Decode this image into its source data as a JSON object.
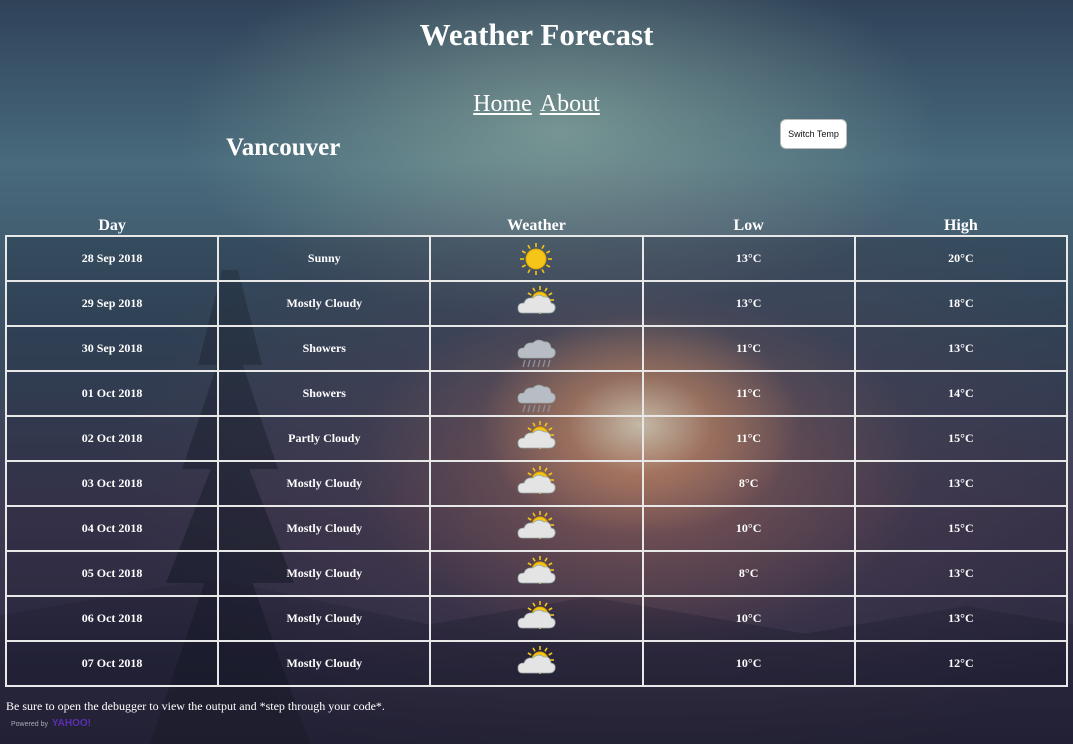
{
  "header": {
    "title": "Weather Forecast"
  },
  "nav": {
    "home": "Home",
    "about": "About"
  },
  "city": "Vancouver",
  "switch_button": "Switch Temp",
  "table": {
    "headers": {
      "day": "Day",
      "condition": "",
      "weather": "Weather",
      "low": "Low",
      "high": "High"
    },
    "rows": [
      {
        "day": "28 Sep 2018",
        "condition": "Sunny",
        "icon": "sunny-icon",
        "low": "13°C",
        "high": "20°C"
      },
      {
        "day": "29 Sep 2018",
        "condition": "Mostly Cloudy",
        "icon": "mostly-cloudy-icon",
        "low": "13°C",
        "high": "18°C"
      },
      {
        "day": "30 Sep 2018",
        "condition": "Showers",
        "icon": "showers-icon",
        "low": "11°C",
        "high": "13°C"
      },
      {
        "day": "01 Oct 2018",
        "condition": "Showers",
        "icon": "showers-icon",
        "low": "11°C",
        "high": "14°C"
      },
      {
        "day": "02 Oct 2018",
        "condition": "Partly Cloudy",
        "icon": "partly-cloudy-icon",
        "low": "11°C",
        "high": "15°C"
      },
      {
        "day": "03 Oct 2018",
        "condition": "Mostly Cloudy",
        "icon": "mostly-cloudy-icon",
        "low": "8°C",
        "high": "13°C"
      },
      {
        "day": "04 Oct 2018",
        "condition": "Mostly Cloudy",
        "icon": "mostly-cloudy-icon",
        "low": "10°C",
        "high": "15°C"
      },
      {
        "day": "05 Oct 2018",
        "condition": "Mostly Cloudy",
        "icon": "mostly-cloudy-icon",
        "low": "8°C",
        "high": "13°C"
      },
      {
        "day": "06 Oct 2018",
        "condition": "Mostly Cloudy",
        "icon": "mostly-cloudy-icon",
        "low": "10°C",
        "high": "13°C"
      },
      {
        "day": "07 Oct 2018",
        "condition": "Mostly Cloudy",
        "icon": "mostly-cloudy-icon",
        "low": "10°C",
        "high": "12°C"
      }
    ]
  },
  "footer": {
    "note": "Be sure to open the debugger to view the output and *step through your code*.",
    "powered_by": "Powered by",
    "brand": "YAHOO!"
  },
  "colors": {
    "sun": "#f5c518",
    "cloud": "#e4e4e4",
    "rain": "#8a8f99"
  }
}
